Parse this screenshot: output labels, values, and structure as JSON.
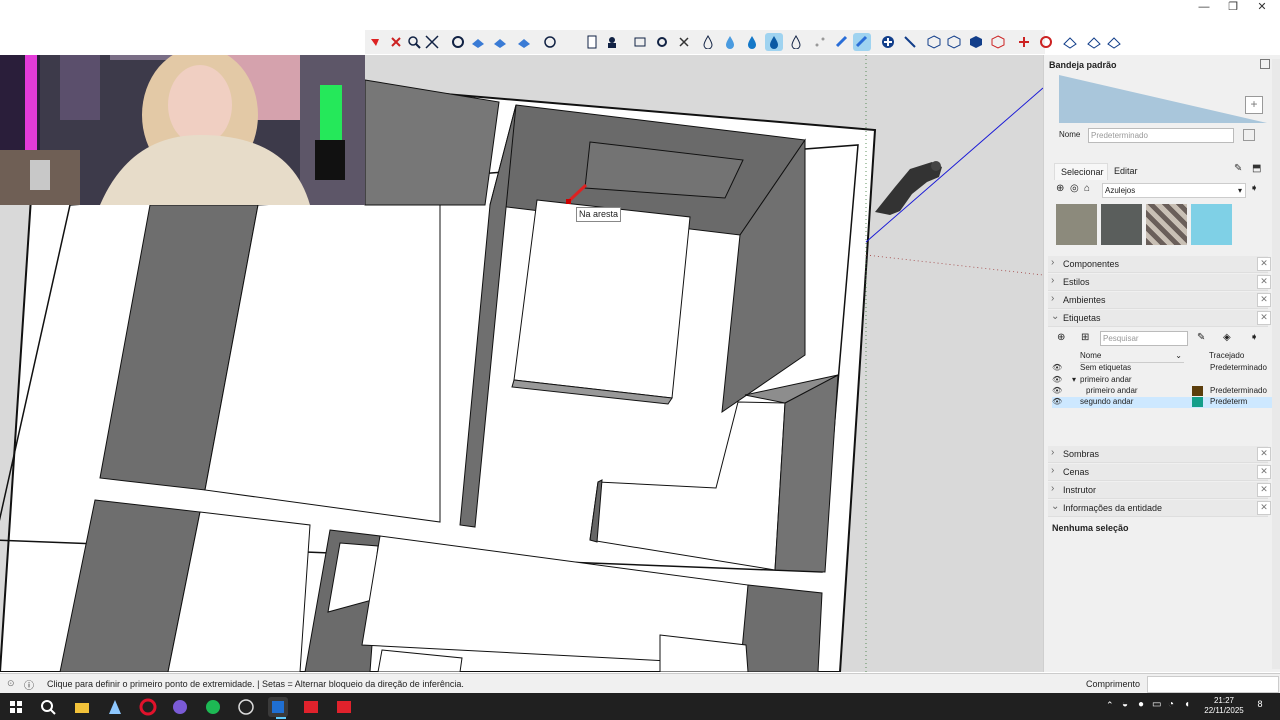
{
  "window": {
    "minimize": "—",
    "maximize": "❐",
    "close": "✕"
  },
  "viewport": {
    "tooltip": "Na aresta"
  },
  "tray": {
    "title": "Bandeja padrão",
    "name_label": "Nome",
    "name_value": "Predeterminado",
    "tab_select": "Selecionar",
    "tab_edit": "Editar",
    "library": "Azulejos",
    "sections_top": [
      {
        "label": "Componentes"
      },
      {
        "label": "Estilos"
      },
      {
        "label": "Ambientes"
      },
      {
        "label": "Etiquetas"
      }
    ],
    "tags": {
      "search_placeholder": "Pesquisar",
      "col_name": "Nome",
      "col_trace": "Tracejado",
      "rows": [
        {
          "name": "Sem etiquetas",
          "trace": "Predeterminado",
          "color": ""
        },
        {
          "name": "primeiro andar",
          "trace": "",
          "color": ""
        },
        {
          "name": "primeiro andar",
          "trace": "Predeterminado",
          "color": "#5c3e0c"
        },
        {
          "name": "segundo andar",
          "trace": "Predeterm",
          "color": "#139e8a"
        }
      ]
    },
    "sections_bottom": [
      {
        "label": "Sombras"
      },
      {
        "label": "Cenas"
      },
      {
        "label": "Instrutor"
      },
      {
        "label": "Informações da entidade"
      }
    ],
    "entity_info": "Nenhuma seleção"
  },
  "status": {
    "hint": "Clique para definir o primeiro ponto de extremidade. | Setas = Alternar bloqueio da direção de inferência.",
    "measure_label": "Comprimento",
    "measure_value": ""
  },
  "taskbar": {
    "time": "21:27",
    "date": "22/11/2025",
    "notifications": "8"
  },
  "colors": {
    "accent": "#0078d7",
    "selected_row": "#cde8ff",
    "axis_blue": "#1a1ad6"
  }
}
